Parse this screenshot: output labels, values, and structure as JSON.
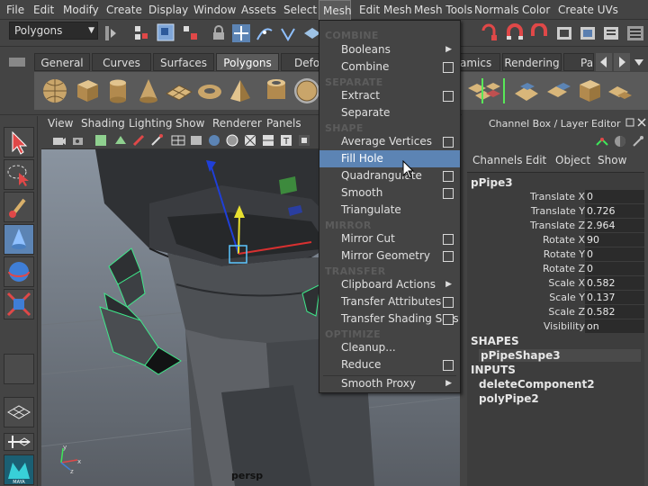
{
  "menubar": {
    "items": [
      "File",
      "Edit",
      "Modify",
      "Create",
      "Display",
      "Window",
      "Assets",
      "Select",
      "Mesh",
      "Edit Mesh",
      "Mesh Tools",
      "Normals",
      "Color",
      "Create UVs"
    ],
    "active": "Mesh"
  },
  "status": {
    "mode": "Polygons"
  },
  "shelf": {
    "tabs": [
      "General",
      "Curves",
      "Surfaces",
      "Polygons",
      "Deform",
      "amics",
      "Rendering",
      "Pa"
    ],
    "active_tab": "Polygons"
  },
  "viewport": {
    "menus": [
      "View",
      "Shading",
      "Lighting",
      "Show",
      "Renderer",
      "Panels"
    ],
    "camera": "persp"
  },
  "mesh_menu": {
    "combine_header": "COMBINE",
    "booleans": "Booleans",
    "combine": "Combine",
    "separate_header": "SEPARATE",
    "extract": "Extract",
    "separate": "Separate",
    "shape_header": "SHAPE",
    "average_vertices": "Average Vertices",
    "fill_hole": "Fill Hole",
    "quadrangulate": "Quadrangulate",
    "smooth": "Smooth",
    "triangulate": "Triangulate",
    "mirror_header": "MIRROR",
    "mirror_cut": "Mirror Cut",
    "mirror_geometry": "Mirror Geometry",
    "transfer_header": "TRANSFER",
    "clipboard_actions": "Clipboard Actions",
    "transfer_attributes": "Transfer Attributes",
    "transfer_shading_sets": "Transfer Shading Sets",
    "optimize_header": "OPTIMIZE",
    "cleanup": "Cleanup...",
    "reduce": "Reduce",
    "smooth_proxy": "Smooth Proxy"
  },
  "channel_box": {
    "title": "Channel Box / Layer Editor",
    "menus": [
      "Channels",
      "Edit",
      "Object",
      "Show"
    ],
    "object_name": "pPipe3",
    "attributes": [
      {
        "name": "Translate X",
        "value": "0"
      },
      {
        "name": "Translate Y",
        "value": "0.726"
      },
      {
        "name": "Translate Z",
        "value": "2.964"
      },
      {
        "name": "Rotate X",
        "value": "90"
      },
      {
        "name": "Rotate Y",
        "value": "0"
      },
      {
        "name": "Rotate Z",
        "value": "0"
      },
      {
        "name": "Scale X",
        "value": "0.582"
      },
      {
        "name": "Scale Y",
        "value": "0.137"
      },
      {
        "name": "Scale Z",
        "value": "0.582"
      },
      {
        "name": "Visibility",
        "value": "on"
      }
    ],
    "shapes_header": "SHAPES",
    "shape_node": "pPipeShape3",
    "inputs_header": "INPUTS",
    "input_nodes": [
      "deleteComponent2",
      "polyPipe2"
    ]
  },
  "colors": {
    "menu_highlight": "#5c84b4",
    "ui_bg": "#444444",
    "selection_wire": "#3ee88a"
  }
}
